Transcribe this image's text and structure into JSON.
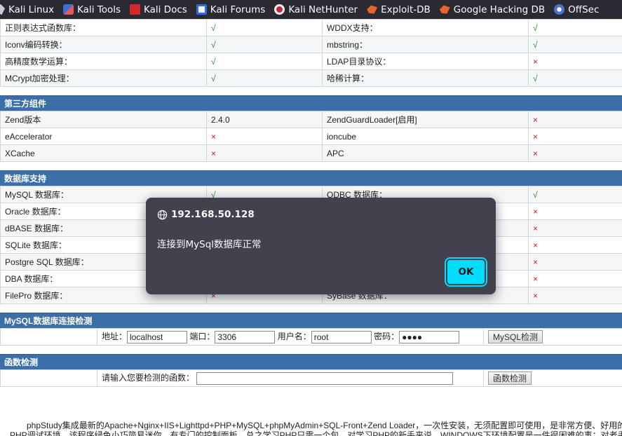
{
  "bookmarks": [
    {
      "label": "Kali Linux",
      "icon": "kali-icon"
    },
    {
      "label": "Kali Tools",
      "icon": "kali-tools-icon"
    },
    {
      "label": "Kali Docs",
      "icon": "kali-docs-icon"
    },
    {
      "label": "Kali Forums",
      "icon": "kali-forums-icon"
    },
    {
      "label": "Kali NetHunter",
      "icon": "nethunter-icon"
    },
    {
      "label": "Exploit-DB",
      "icon": "exploit-db-icon"
    },
    {
      "label": "Google Hacking DB",
      "icon": "ghdb-icon"
    },
    {
      "label": "OffSec",
      "icon": "offsec-icon"
    }
  ],
  "top_rows": [
    {
      "l1": "正则表达式函数库：",
      "v1": "√",
      "l2": "WDDX支持：",
      "v2": "√"
    },
    {
      "l1": "Iconv编码转换：",
      "v1": "√",
      "l2": "mbstring：",
      "v2": "√"
    },
    {
      "l1": "高精度数学运算：",
      "v1": "√",
      "l2": "LDAP目录协议：",
      "v2": "×"
    },
    {
      "l1": "MCrypt加密处理：",
      "v1": "√",
      "l2": "哈稀计算：",
      "v2": "√"
    }
  ],
  "third_party": {
    "title": "第三方组件",
    "rows": [
      {
        "l1": "Zend版本",
        "v1": "2.4.0",
        "l2": "ZendGuardLoader[启用]",
        "v2": "×"
      },
      {
        "l1": "eAccelerator",
        "v1": "×",
        "l2": "ioncube",
        "v2": "×"
      },
      {
        "l1": "XCache",
        "v1": "×",
        "l2": "APC",
        "v2": "×"
      }
    ]
  },
  "database": {
    "title": "数据库支持",
    "rows": [
      {
        "l1": "MySQL 数据库：",
        "v1": "√",
        "l2": "ODBC 数据库：",
        "v2": "√"
      },
      {
        "l1": "Oracle 数据库：",
        "v1": "×",
        "l2": "",
        "v2": "×"
      },
      {
        "l1": "dBASE 数据库：",
        "v1": "×",
        "l2": "",
        "v2": "×"
      },
      {
        "l1": "SQLite 数据库：",
        "v1": "×",
        "l2": "",
        "v2": "×"
      },
      {
        "l1": "Postgre SQL 数据库：",
        "v1": "×",
        "l2": "",
        "v2": "×"
      },
      {
        "l1": "DBA 数据库：",
        "v1": "×",
        "l2": "",
        "v2": "×"
      },
      {
        "l1": "FilePro 数据库：",
        "v1": "×",
        "l2": "SyBase 数据库：",
        "v2": "×"
      }
    ]
  },
  "mysql_check": {
    "title": "MySQL数据库连接检测",
    "address_label": "地址：",
    "address_value": "localhost",
    "port_label": "端口：",
    "port_value": "3306",
    "user_label": "用户名：",
    "user_value": "root",
    "password_label": "密码：",
    "password_value": "●●●●",
    "button": "MySQL检测"
  },
  "function_check": {
    "title": "函数检测",
    "prompt": "请输入您要检测的函数：",
    "input_value": "",
    "button": "函数检测"
  },
  "intro": {
    "line1": "phpStudy集成最新的Apache+Nginx+IIS+Lighttpd+PHP+MySQL+phpMyAdmin+SQL-Front+Zend Loader，一次性安装，无须配置即可使用，是非常方便、好用的",
    "line2": "PHP调试环境，该程序绿色小巧简易迷你，有专门的控制面板，总之学习PHP只需一个包。对学习PHP的新手来说，WINDOWS下环境配置是一件很困难的事；对老手"
  },
  "dialog": {
    "origin": "192.168.50.128",
    "message": "连接到MySql数据库正常",
    "ok_label": "OK"
  },
  "colors": {
    "section_bg": "#3c6fa8",
    "check_green": "#1a8c1a",
    "cross_red": "#d51818",
    "dialog_bg": "#42414d",
    "ok_button": "#00ddff",
    "toolbar_bg": "#2b2a33"
  }
}
